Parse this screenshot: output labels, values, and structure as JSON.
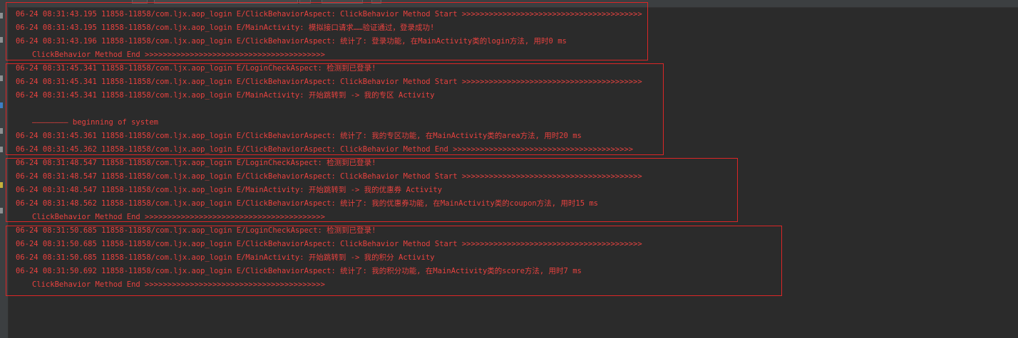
{
  "colors": {
    "background": "#2b2b2b",
    "log_text": "#e8423f",
    "highlight_box": "#dc2626",
    "sidebar": "#3c3f41"
  },
  "log_lines": [
    "06-24 08:31:43.195 11858-11858/com.ljx.aop_login E/ClickBehaviorAspect: ClickBehavior Method Start >>>>>>>>>>>>>>>>>>>>>>>>>>>>>>>>>>>>>>>>",
    "06-24 08:31:43.195 11858-11858/com.ljx.aop_login E/MainActivity: 模拟接口请求……验证通过，登录成功!",
    "06-24 08:31:43.196 11858-11858/com.ljx.aop_login E/ClickBehaviorAspect: 统计了: 登录功能, 在MainActivity类的login方法, 用时0 ms",
    "ClickBehavior Method End >>>>>>>>>>>>>>>>>>>>>>>>>>>>>>>>>>>>>>>>",
    "06-24 08:31:45.341 11858-11858/com.ljx.aop_login E/LoginCheckAspect: 检测到已登录!",
    "06-24 08:31:45.341 11858-11858/com.ljx.aop_login E/ClickBehaviorAspect: ClickBehavior Method Start >>>>>>>>>>>>>>>>>>>>>>>>>>>>>>>>>>>>>>>>",
    "06-24 08:31:45.341 11858-11858/com.ljx.aop_login E/MainActivity: 开始跳转到 -> 我的专区 Activity",
    "",
    "———————— beginning of system",
    "06-24 08:31:45.361 11858-11858/com.ljx.aop_login E/ClickBehaviorAspect: 统计了: 我的专区功能, 在MainActivity类的area方法, 用时20 ms",
    "06-24 08:31:45.362 11858-11858/com.ljx.aop_login E/ClickBehaviorAspect: ClickBehavior Method End >>>>>>>>>>>>>>>>>>>>>>>>>>>>>>>>>>>>>>>>",
    "06-24 08:31:48.547 11858-11858/com.ljx.aop_login E/LoginCheckAspect: 检测到已登录!",
    "06-24 08:31:48.547 11858-11858/com.ljx.aop_login E/ClickBehaviorAspect: ClickBehavior Method Start >>>>>>>>>>>>>>>>>>>>>>>>>>>>>>>>>>>>>>>>",
    "06-24 08:31:48.547 11858-11858/com.ljx.aop_login E/MainActivity: 开始跳转到 -> 我的优惠券 Activity",
    "06-24 08:31:48.562 11858-11858/com.ljx.aop_login E/ClickBehaviorAspect: 统计了: 我的优惠券功能, 在MainActivity类的coupon方法, 用时15 ms",
    "ClickBehavior Method End >>>>>>>>>>>>>>>>>>>>>>>>>>>>>>>>>>>>>>>>",
    "06-24 08:31:50.685 11858-11858/com.ljx.aop_login E/LoginCheckAspect: 检测到已登录!",
    "06-24 08:31:50.685 11858-11858/com.ljx.aop_login E/ClickBehaviorAspect: ClickBehavior Method Start >>>>>>>>>>>>>>>>>>>>>>>>>>>>>>>>>>>>>>>>",
    "06-24 08:31:50.685 11858-11858/com.ljx.aop_login E/MainActivity: 开始跳转到 -> 我的积分 Activity",
    "06-24 08:31:50.692 11858-11858/com.ljx.aop_login E/ClickBehaviorAspect: 统计了: 我的积分功能, 在MainActivity类的score方法, 用时7 ms",
    "ClickBehavior Method End >>>>>>>>>>>>>>>>>>>>>>>>>>>>>>>>>>>>>>>>"
  ]
}
